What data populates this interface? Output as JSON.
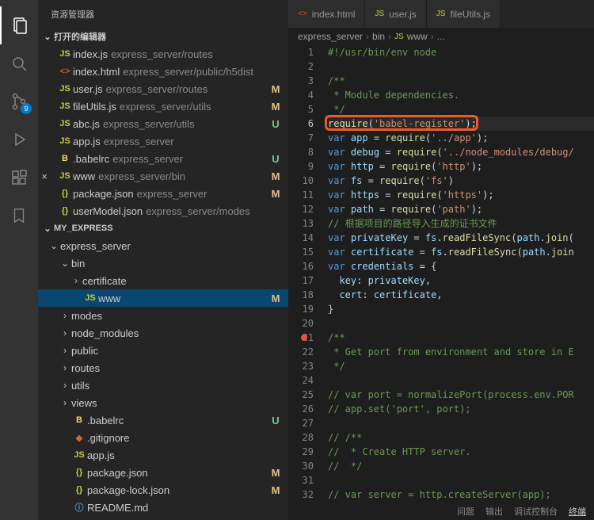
{
  "activity": {
    "scm_badge": "9"
  },
  "sidebar": {
    "title": "资源管理器",
    "open_editors_label": "打开的编辑器",
    "open_editors": [
      {
        "icon": "JS",
        "iconcls": "js",
        "name": "index.js",
        "path": "express_server/routes",
        "status": ""
      },
      {
        "icon": "<>",
        "iconcls": "html",
        "name": "index.html",
        "path": "express_server/public/h5dist",
        "status": ""
      },
      {
        "icon": "JS",
        "iconcls": "js",
        "name": "user.js",
        "path": "express_server/routes",
        "status": "M"
      },
      {
        "icon": "JS",
        "iconcls": "js",
        "name": "fileUtils.js",
        "path": "express_server/utils",
        "status": "M"
      },
      {
        "icon": "JS",
        "iconcls": "js",
        "name": "abc.js",
        "path": "express_server/utils",
        "status": "U"
      },
      {
        "icon": "JS",
        "iconcls": "js",
        "name": "app.js",
        "path": "express_server",
        "status": ""
      },
      {
        "icon": "B",
        "iconcls": "babel",
        "name": ".babelrc",
        "path": "express_server",
        "status": "U"
      },
      {
        "icon": "JS",
        "iconcls": "js",
        "name": "www",
        "path": "express_server/bin",
        "status": "M",
        "active": true
      },
      {
        "icon": "{}",
        "iconcls": "json",
        "name": "package.json",
        "path": "express_server",
        "status": "M"
      },
      {
        "icon": "{}",
        "iconcls": "json",
        "name": "userModel.json",
        "path": "express_server/modes",
        "status": ""
      }
    ],
    "workspace_label": "MY_EXPRESS",
    "tree": [
      {
        "depth": 0,
        "chev": "v",
        "name": "express_server",
        "icon": "",
        "status": ""
      },
      {
        "depth": 1,
        "chev": "v",
        "name": "bin",
        "icon": "",
        "status": ""
      },
      {
        "depth": 2,
        "chev": ">",
        "name": "certificate",
        "icon": "",
        "status": ""
      },
      {
        "depth": 2,
        "chev": "",
        "name": "www",
        "icon": "JS",
        "iconcls": "js",
        "status": "M",
        "selected": true
      },
      {
        "depth": 1,
        "chev": ">",
        "name": "modes",
        "icon": "",
        "status": ""
      },
      {
        "depth": 1,
        "chev": ">",
        "name": "node_modules",
        "icon": "",
        "status": ""
      },
      {
        "depth": 1,
        "chev": ">",
        "name": "public",
        "icon": "",
        "status": ""
      },
      {
        "depth": 1,
        "chev": ">",
        "name": "routes",
        "icon": "",
        "status": ""
      },
      {
        "depth": 1,
        "chev": ">",
        "name": "utils",
        "icon": "",
        "status": ""
      },
      {
        "depth": 1,
        "chev": ">",
        "name": "views",
        "icon": "",
        "status": ""
      },
      {
        "depth": 1,
        "chev": "",
        "name": ".babelrc",
        "icon": "B",
        "iconcls": "babel",
        "status": "U"
      },
      {
        "depth": 1,
        "chev": "",
        "name": ".gitignore",
        "icon": "◆",
        "iconcls": "git",
        "status": ""
      },
      {
        "depth": 1,
        "chev": "",
        "name": "app.js",
        "icon": "JS",
        "iconcls": "js",
        "status": ""
      },
      {
        "depth": 1,
        "chev": "",
        "name": "package.json",
        "icon": "{}",
        "iconcls": "json",
        "status": "M"
      },
      {
        "depth": 1,
        "chev": "",
        "name": "package-lock.json",
        "icon": "{}",
        "iconcls": "json",
        "status": "M"
      },
      {
        "depth": 1,
        "chev": "",
        "name": "README.md",
        "icon": "ⓘ",
        "iconcls": "md",
        "status": ""
      }
    ]
  },
  "tabs": [
    {
      "icon": "<>",
      "iconcls": "html",
      "label": "index.html"
    },
    {
      "icon": "JS",
      "iconcls": "js",
      "label": "user.js"
    },
    {
      "icon": "JS",
      "iconcls": "js",
      "label": "fileUtils.js"
    }
  ],
  "breadcrumb": {
    "p0": "express_server",
    "p1": "bin",
    "p2": "www",
    "p2icon": "JS",
    "p3": "..."
  },
  "code": {
    "lines": [
      {
        "n": 1,
        "html": "<span class='c-comment'>#!/usr/bin/env node</span>"
      },
      {
        "n": 2,
        "html": ""
      },
      {
        "n": 3,
        "html": "<span class='c-comment'>/**</span>"
      },
      {
        "n": 4,
        "html": "<span class='c-comment'> * Module dependencies.</span>"
      },
      {
        "n": 5,
        "html": "<span class='c-comment'> */</span>"
      },
      {
        "n": 6,
        "html": "<span class='c-fn'>require</span><span class='c-plain'>(</span><span class='c-str'>'babel-register'</span><span class='c-plain'>);</span>",
        "hl": true,
        "box": true
      },
      {
        "n": 7,
        "html": "<span class='c-kw'>var</span> <span class='c-var'>app</span> = <span class='c-fn'>require</span>(<span class='c-str'>'../app'</span>);"
      },
      {
        "n": 8,
        "html": "<span class='c-kw'>var</span> <span class='c-var'>debug</span> = <span class='c-fn'>require</span>(<span class='c-str'>'../node_modules/debug/</span>"
      },
      {
        "n": 9,
        "html": "<span class='c-kw'>var</span> <span class='c-var'>http</span> = <span class='c-fn'>require</span>(<span class='c-str'>'http'</span>);"
      },
      {
        "n": 10,
        "html": "<span class='c-kw'>var</span> <span class='c-var'>fs</span> = <span class='c-fn'>require</span>(<span class='c-str'>'fs'</span>)"
      },
      {
        "n": 11,
        "html": "<span class='c-kw'>var</span> <span class='c-var'>https</span> = <span class='c-fn'>require</span>(<span class='c-str'>'https'</span>);"
      },
      {
        "n": 12,
        "html": "<span class='c-kw'>var</span> <span class='c-var'>path</span> = <span class='c-fn'>require</span>(<span class='c-str'>'path'</span>);"
      },
      {
        "n": 13,
        "html": "<span class='c-comment'>// 根据项目的路径导入生成的证书文件</span>"
      },
      {
        "n": 14,
        "html": "<span class='c-kw'>var</span> <span class='c-var'>privateKey</span> = <span class='c-var'>fs</span>.<span class='c-fn'>readFileSync</span>(<span class='c-var'>path</span>.<span class='c-fn'>join</span>("
      },
      {
        "n": 15,
        "html": "<span class='c-kw'>var</span> <span class='c-var'>certificate</span> = <span class='c-var'>fs</span>.<span class='c-fn'>readFileSync</span>(<span class='c-var'>path</span>.<span class='c-fn'>join</span>"
      },
      {
        "n": 16,
        "html": "<span class='c-kw'>var</span> <span class='c-var'>credentials</span> = {"
      },
      {
        "n": 17,
        "html": "  <span class='c-var'>key</span>: <span class='c-var'>privateKey</span>,"
      },
      {
        "n": 18,
        "html": "  <span class='c-var'>cert</span>: <span class='c-var'>certificate</span>,"
      },
      {
        "n": 19,
        "html": "}"
      },
      {
        "n": 20,
        "html": ""
      },
      {
        "n": 21,
        "html": "<span class='c-comment'>/**</span>",
        "err": true
      },
      {
        "n": 22,
        "html": "<span class='c-comment'> * Get port from environment and store in E</span>"
      },
      {
        "n": 23,
        "html": "<span class='c-comment'> */</span>"
      },
      {
        "n": 24,
        "html": ""
      },
      {
        "n": 25,
        "html": "<span class='c-comment'>// var port = normalizePort(process.env.POR</span>"
      },
      {
        "n": 26,
        "html": "<span class='c-comment'>// app.set('port', port);</span>"
      },
      {
        "n": 27,
        "html": ""
      },
      {
        "n": 28,
        "html": "<span class='c-comment'>// /**</span>"
      },
      {
        "n": 29,
        "html": "<span class='c-comment'>//  * Create HTTP server.</span>"
      },
      {
        "n": 30,
        "html": "<span class='c-comment'>//  */</span>"
      },
      {
        "n": 31,
        "html": ""
      },
      {
        "n": 32,
        "html": "<span class='c-comment'>// var server = http.createServer(app);</span>"
      }
    ]
  },
  "statusbar": {
    "a": "问题",
    "b": "输出",
    "c": "调试控制台",
    "d": "终端"
  }
}
